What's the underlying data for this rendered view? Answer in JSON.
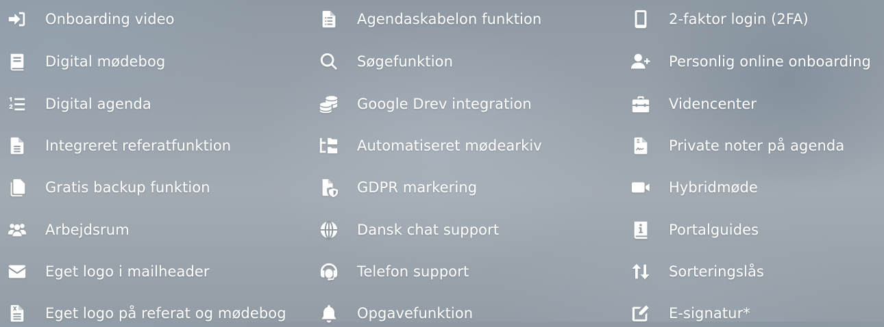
{
  "columns": [
    {
      "items": [
        {
          "label": "Onboarding video",
          "icon": "sign-in-icon"
        },
        {
          "label": "Digital mødebog",
          "icon": "book-icon"
        },
        {
          "label": "Digital agenda",
          "icon": "numbered-list-icon"
        },
        {
          "label": "Integreret referatfunktion",
          "icon": "document-icon"
        },
        {
          "label": "Gratis backup funktion",
          "icon": "copy-files-icon"
        },
        {
          "label": "Arbejdsrum",
          "icon": "users-icon"
        },
        {
          "label": "Eget logo i mailheader",
          "icon": "envelope-icon"
        },
        {
          "label": "Eget logo på referat og mødebog",
          "icon": "excel-file-icon"
        }
      ]
    },
    {
      "items": [
        {
          "label": "Agendaskabelon funktion",
          "icon": "file-list-icon"
        },
        {
          "label": "Søgefunktion",
          "icon": "search-icon"
        },
        {
          "label": "Google Drev integration",
          "icon": "database-coins-icon"
        },
        {
          "label": "Automatiseret mødearkiv",
          "icon": "folder-tree-icon"
        },
        {
          "label": "GDPR markering",
          "icon": "file-shield-icon"
        },
        {
          "label": "Dansk chat support",
          "icon": "globe-icon"
        },
        {
          "label": "Telefon support",
          "icon": "headset-icon"
        },
        {
          "label": "Opgavefunktion",
          "icon": "bell-icon"
        }
      ]
    },
    {
      "items": [
        {
          "label": "2-faktor login (2FA)",
          "icon": "mobile-phone-icon"
        },
        {
          "label": "Personlig online onboarding",
          "icon": "user-plus-icon"
        },
        {
          "label": "Videncenter",
          "icon": "toolbox-icon"
        },
        {
          "label": "Private noter på agenda",
          "icon": "file-signature-icon"
        },
        {
          "label": "Hybridmøde",
          "icon": "video-camera-icon"
        },
        {
          "label": "Portalguides",
          "icon": "info-book-icon"
        },
        {
          "label": "Sorteringslås",
          "icon": "sort-arrows-icon"
        },
        {
          "label": "E-signatur*",
          "icon": "pen-square-icon"
        }
      ]
    }
  ]
}
